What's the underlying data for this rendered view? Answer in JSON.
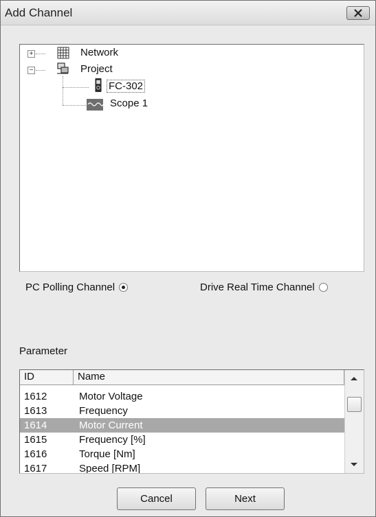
{
  "window": {
    "title": "Add Channel",
    "close_icon": "close-icon"
  },
  "tree": {
    "nodes": [
      {
        "label": "Network",
        "icon": "network-grid-icon",
        "expander": "+"
      },
      {
        "label": "Project",
        "icon": "project-icon",
        "expander": "−"
      },
      {
        "label": "FC-302",
        "icon": "drive-icon",
        "selected": true
      },
      {
        "label": "Scope 1",
        "icon": "scope-icon"
      }
    ]
  },
  "channel_type": {
    "pc_polling": {
      "label": "PC Polling Channel",
      "checked": true
    },
    "drive_realtime": {
      "label": "Drive Real Time Channel",
      "checked": false
    }
  },
  "parameter": {
    "label": "Parameter",
    "columns": {
      "id": "ID",
      "name": "Name"
    },
    "rows": [
      {
        "id": "1612",
        "name": "Motor Voltage"
      },
      {
        "id": "1613",
        "name": "Frequency"
      },
      {
        "id": "1614",
        "name": "Motor Current",
        "selected": true
      },
      {
        "id": "1615",
        "name": "Frequency [%]"
      },
      {
        "id": "1616",
        "name": "Torque [Nm]"
      },
      {
        "id": "1617",
        "name": "Speed [RPM]"
      }
    ]
  },
  "buttons": {
    "cancel": "Cancel",
    "next": "Next"
  },
  "colors": {
    "selection": "#a8a8a8",
    "window_bg": "#eaeaea"
  }
}
